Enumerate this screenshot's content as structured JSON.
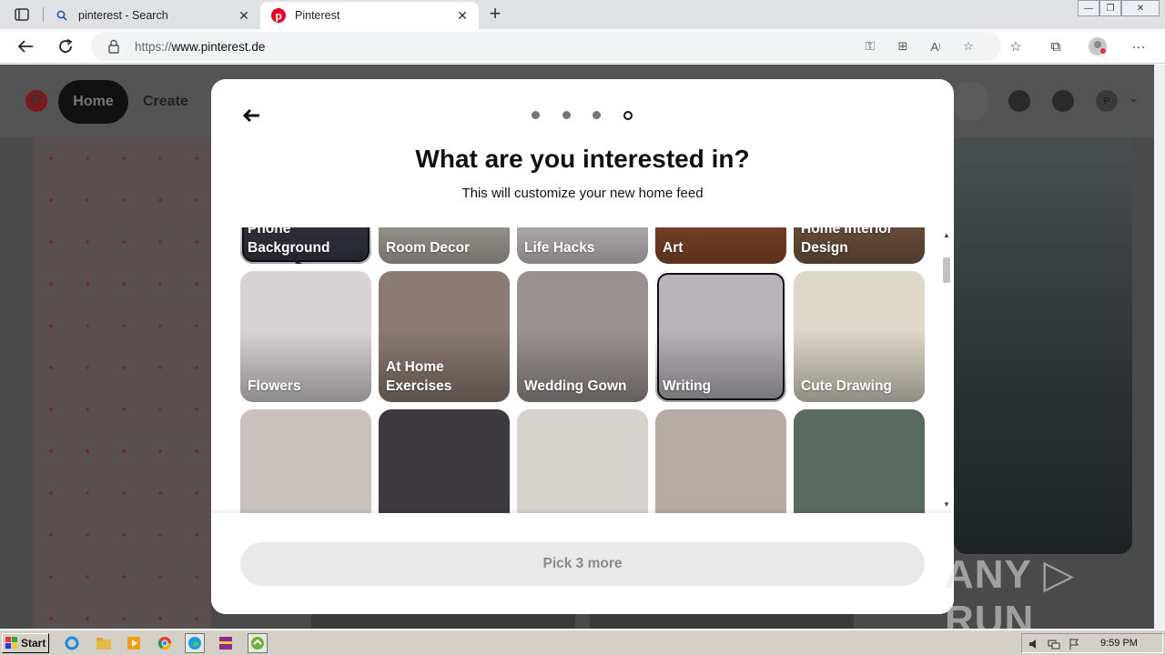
{
  "browser": {
    "tabs": [
      {
        "title": "pinterest - Search",
        "active": false,
        "icon": "search-icon"
      },
      {
        "title": "Pinterest",
        "active": true,
        "icon": "pinterest-icon"
      }
    ],
    "url_scheme": "https://",
    "url_host": "www.pinterest.de"
  },
  "site_header": {
    "home_label": "Home",
    "create_label": "Create",
    "avatar_letter": "P"
  },
  "modal": {
    "title": "What are you interested in?",
    "subtitle": "This will customize your new home feed",
    "steps_total": 4,
    "current_step": 4,
    "topics": [
      {
        "label": "Phone Background",
        "selected": true,
        "color": "#373845"
      },
      {
        "label": "Room Decor",
        "selected": false,
        "color": "#b3ada4"
      },
      {
        "label": "Life Hacks",
        "selected": false,
        "color": "#cfc9cc"
      },
      {
        "label": "Art",
        "selected": false,
        "color": "#8b4a2c"
      },
      {
        "label": "Home Interior Design",
        "selected": false,
        "color": "#7a5a45"
      },
      {
        "label": "Flowers",
        "selected": false,
        "color": "#d8d4d6"
      },
      {
        "label": "At Home Exercises",
        "selected": false,
        "color": "#8c7b72"
      },
      {
        "label": "Wedding Gown",
        "selected": false,
        "color": "#9a9290"
      },
      {
        "label": "Writing",
        "selected": true,
        "color": "#b7b3b9"
      },
      {
        "label": "Cute Drawing",
        "selected": false,
        "color": "#ddd8c8"
      },
      {
        "label": "",
        "selected": false,
        "color": "#c9c2bd"
      },
      {
        "label": "",
        "selected": false,
        "color": "#3c3a3e"
      },
      {
        "label": "",
        "selected": false,
        "color": "#d7d3cf"
      },
      {
        "label": "",
        "selected": false,
        "color": "#b5aca5"
      },
      {
        "label": "",
        "selected": false,
        "color": "#596a60"
      }
    ],
    "footer_button": "Pick 3 more"
  },
  "watermark": "ANY ▷ RUN",
  "taskbar": {
    "start_label": "Start",
    "clock": "9:59 PM"
  },
  "colors": {
    "pinterest_red": "#e60023",
    "selected_border": "#111111",
    "disabled_button": "#e9e9e9"
  }
}
